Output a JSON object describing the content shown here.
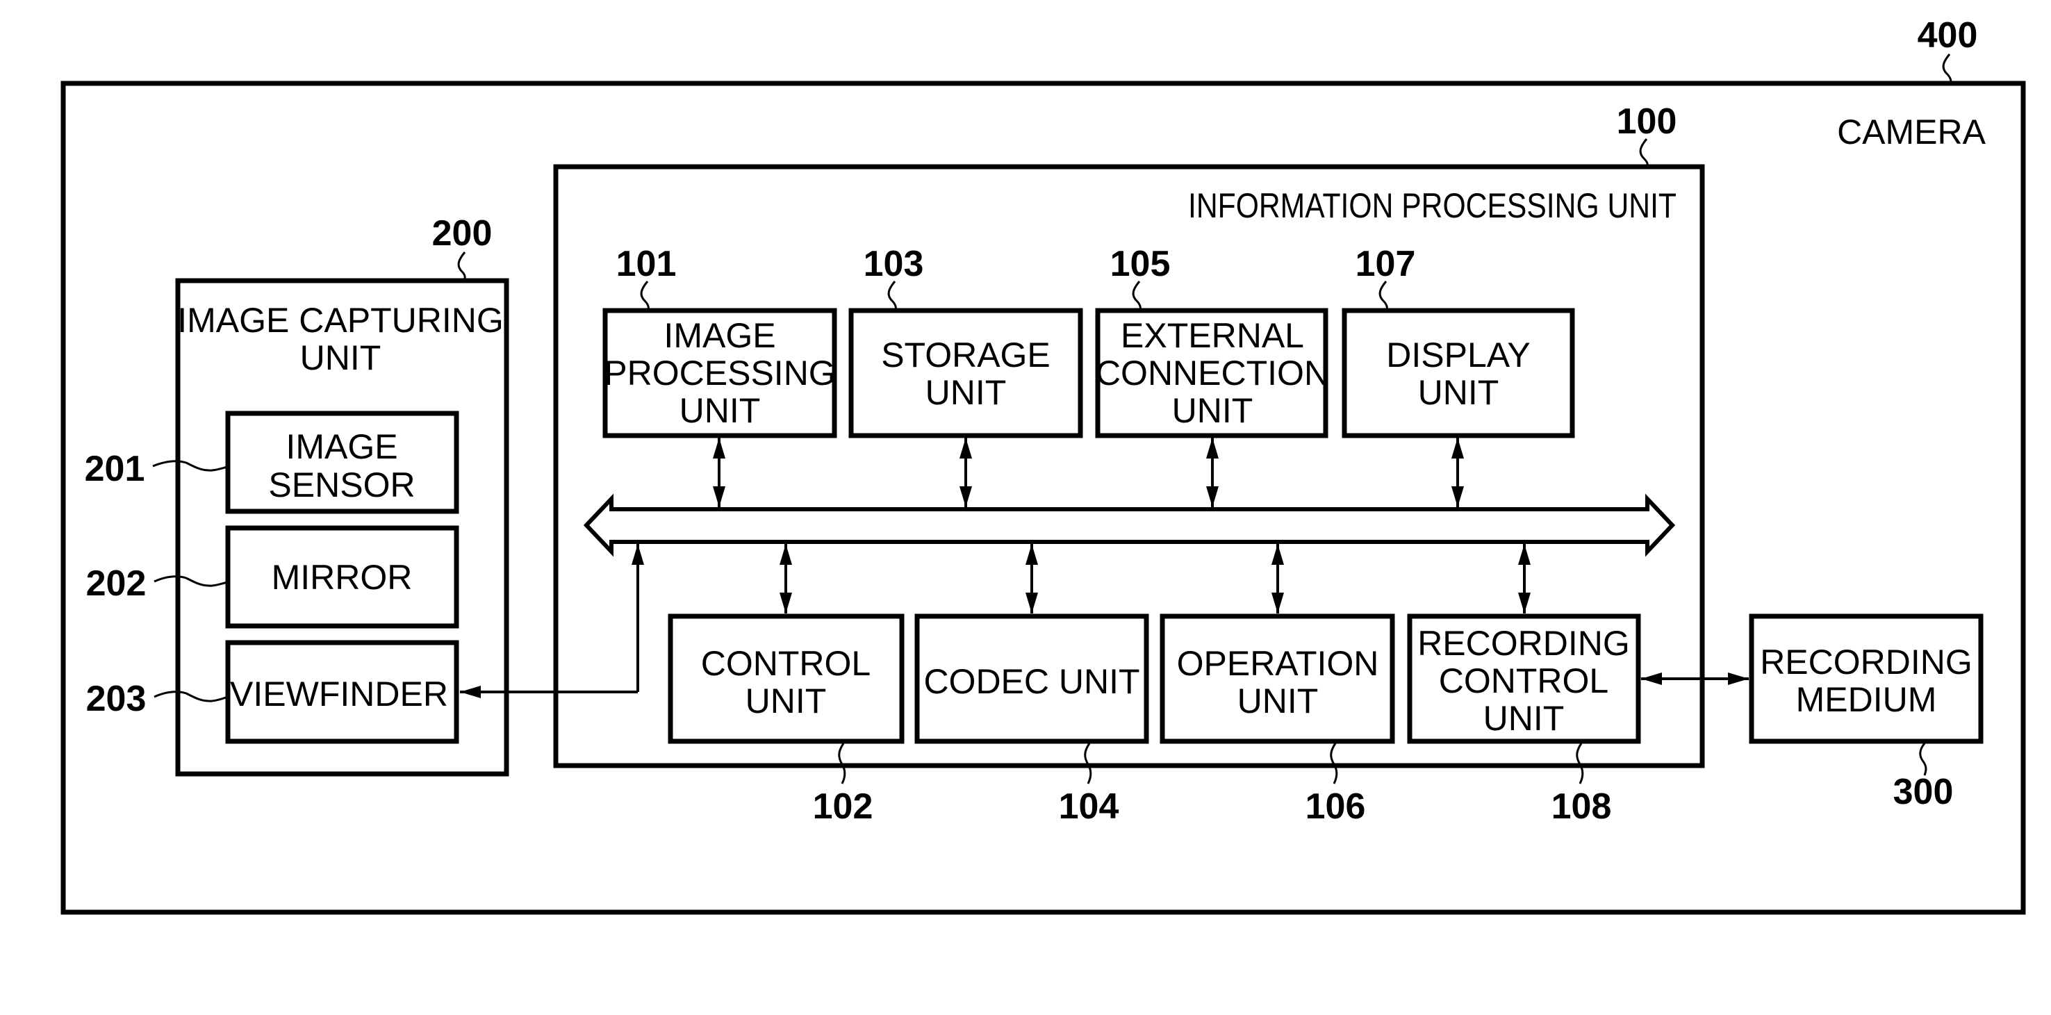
{
  "figure": {
    "camera": {
      "ref": "400",
      "label": "CAMERA"
    },
    "information_processing_unit": {
      "ref": "100",
      "label": "INFORMATION PROCESSING UNIT"
    },
    "image_capturing_unit": {
      "ref": "200",
      "label_lines": [
        "IMAGE CAPTURING",
        "UNIT"
      ]
    },
    "recording_medium": {
      "ref": "300",
      "label_lines": [
        "RECORDING",
        "MEDIUM"
      ]
    },
    "top_units": [
      {
        "ref": "101",
        "label_lines": [
          "IMAGE",
          "PROCESSING",
          "UNIT"
        ]
      },
      {
        "ref": "103",
        "label_lines": [
          "STORAGE",
          "UNIT"
        ]
      },
      {
        "ref": "105",
        "label_lines": [
          "EXTERNAL",
          "CONNECTION",
          "UNIT"
        ]
      },
      {
        "ref": "107",
        "label_lines": [
          "DISPLAY",
          "UNIT"
        ]
      }
    ],
    "bottom_units": [
      {
        "ref": "102",
        "label_lines": [
          "CONTROL",
          "UNIT"
        ]
      },
      {
        "ref": "104",
        "label_lines": [
          "CODEC UNIT"
        ]
      },
      {
        "ref": "106",
        "label_lines": [
          "OPERATION",
          "UNIT"
        ]
      },
      {
        "ref": "108",
        "label_lines": [
          "RECORDING",
          "CONTROL",
          "UNIT"
        ]
      }
    ],
    "capture_components": [
      {
        "ref": "201",
        "label_lines": [
          "IMAGE",
          "SENSOR"
        ]
      },
      {
        "ref": "202",
        "label_lines": [
          "MIRROR"
        ]
      },
      {
        "ref": "203",
        "label_lines": [
          "VIEWFINDER"
        ]
      }
    ],
    "connections": [
      {
        "from": "101",
        "to": "bus",
        "direction": "bidirectional"
      },
      {
        "from": "103",
        "to": "bus",
        "direction": "bidirectional"
      },
      {
        "from": "105",
        "to": "bus",
        "direction": "bidirectional"
      },
      {
        "from": "107",
        "to": "bus",
        "direction": "bidirectional"
      },
      {
        "from": "102",
        "to": "bus",
        "direction": "bidirectional"
      },
      {
        "from": "104",
        "to": "bus",
        "direction": "bidirectional"
      },
      {
        "from": "106",
        "to": "bus",
        "direction": "bidirectional"
      },
      {
        "from": "108",
        "to": "bus",
        "direction": "bidirectional"
      },
      {
        "from": "bus",
        "to": "203",
        "direction": "bidirectional"
      },
      {
        "from": "108",
        "to": "300",
        "direction": "bidirectional"
      }
    ]
  }
}
